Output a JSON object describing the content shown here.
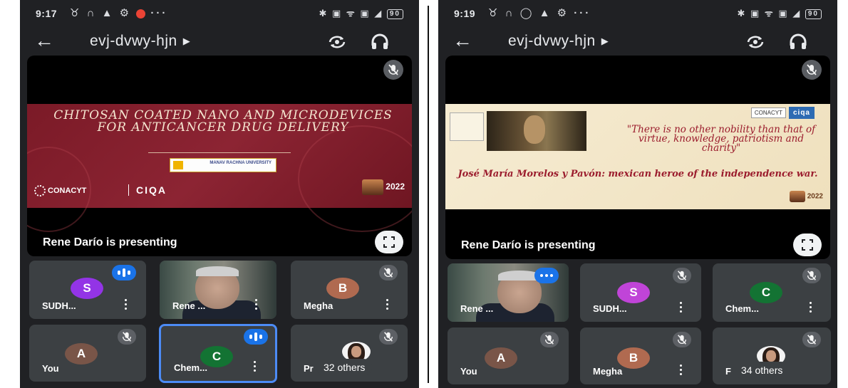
{
  "left": {
    "status": {
      "time": "9:17",
      "battery": "90"
    },
    "meeting": {
      "code": "evj-dvwy-hjn"
    },
    "stage": {
      "presenting_text": "Rene Darío is presenting",
      "slide": {
        "title": "CHITOSAN COATED NANO AND MICRODEVICES FOR ANTICANCER DRUG DELIVERY",
        "university": "MANAV RACHNA UNIVERSITY",
        "org1": "CONACYT",
        "org2": "CIQA",
        "year": "2022"
      }
    },
    "tiles": [
      {
        "initial": "S",
        "name": "SUDH...",
        "color": "#9334e6"
      },
      {
        "name": "Rene ..."
      },
      {
        "initial": "B",
        "name": "Megha",
        "color": "#b06a50"
      },
      {
        "initial": "A",
        "name": "You",
        "color": "#795548"
      },
      {
        "initial": "C",
        "name": "Chem...",
        "color": "#137333"
      },
      {
        "name": "Pr",
        "others": "32 others"
      }
    ]
  },
  "right": {
    "status": {
      "time": "9:19",
      "battery": "90"
    },
    "meeting": {
      "code": "evj-dvwy-hjn"
    },
    "stage": {
      "presenting_text": "Rene Darío is presenting",
      "slide": {
        "quote": "\"There is no other nobility than that of virtue, knowledge, patriotism and charity\"",
        "caption": "José María Morelos y Pavón: mexican heroe of the independence war.",
        "org1": "CONACYT",
        "org2": "ciqa",
        "year": "2022"
      }
    },
    "tiles": [
      {
        "name": "Rene ..."
      },
      {
        "initial": "S",
        "name": "SUDH...",
        "color": "#c044d8"
      },
      {
        "initial": "C",
        "name": "Chem...",
        "color": "#137333"
      },
      {
        "initial": "A",
        "name": "You",
        "color": "#795548"
      },
      {
        "initial": "B",
        "name": "Megha",
        "color": "#b06a50"
      },
      {
        "name": "F",
        "others": "34 others"
      }
    ]
  }
}
